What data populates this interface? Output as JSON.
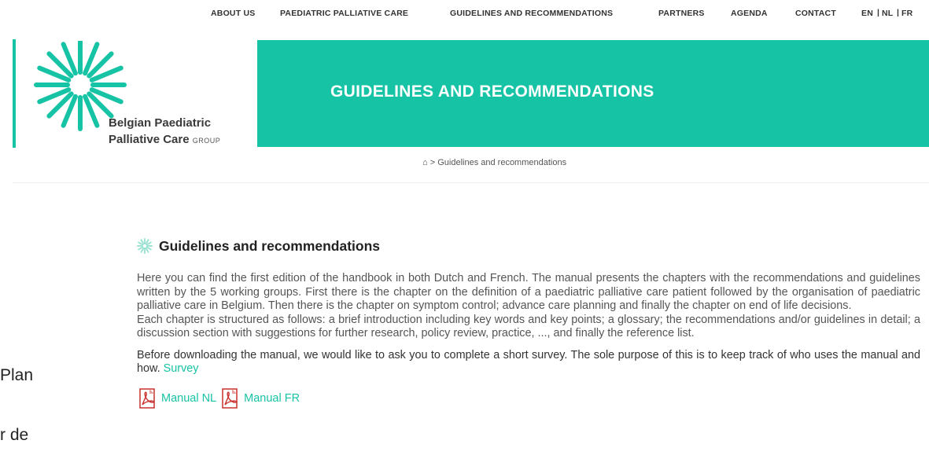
{
  "nav": {
    "items": [
      "ABOUT US",
      "PAEDIATRIC PALLIATIVE CARE",
      "GUIDELINES AND RECOMMENDATIONS",
      "PARTNERS",
      "AGENDA",
      "CONTACT"
    ],
    "languages": [
      "EN",
      "NL",
      "FR"
    ]
  },
  "logo": {
    "line1": "Belgian Paediatric",
    "line2": "Palliative Care",
    "line2_small": "GROUP",
    "icon": "sunburst-logo-icon"
  },
  "banner": {
    "title": "GUIDELINES AND RECOMMENDATIONS"
  },
  "breadcrumb": {
    "home_icon": "home-icon",
    "separator": ">",
    "current": "Guidelines and recommendations"
  },
  "main": {
    "heading": "Guidelines and recommendations",
    "paragraph1": "Here you can find the first edition of the handbook in both Dutch and French. The manual presents the chapters with the recommendations and guidelines written by the 5 working groups. First there is the chapter on the definition of a paediatric palliative care patient followed by the organisation of paediatric palliative care in Belgium. Then there is the chapter on symptom control; advance care planning and finally the chapter on end of life decisions.",
    "paragraph2": "Each chapter is structured as follows: a brief introduction including key words and key points; a glossary; the recommendations and/or guidelines in detail; a discussion section with suggestions for further research, policy review, practice, ..., and finally the reference list.",
    "survey_text": "Before downloading the manual, we would like to ask you to complete a short survey. The sole purpose of this is to keep track of who uses the manual and how.",
    "survey_link": "Survey",
    "downloads": [
      {
        "label": "Manual NL",
        "icon": "pdf-icon"
      },
      {
        "label": "Manual FR",
        "icon": "pdf-icon"
      }
    ]
  },
  "stray_text": {
    "line1": "Plan",
    "line2": "r de"
  },
  "colors": {
    "accent": "#17c3a5",
    "text": "#555555"
  }
}
